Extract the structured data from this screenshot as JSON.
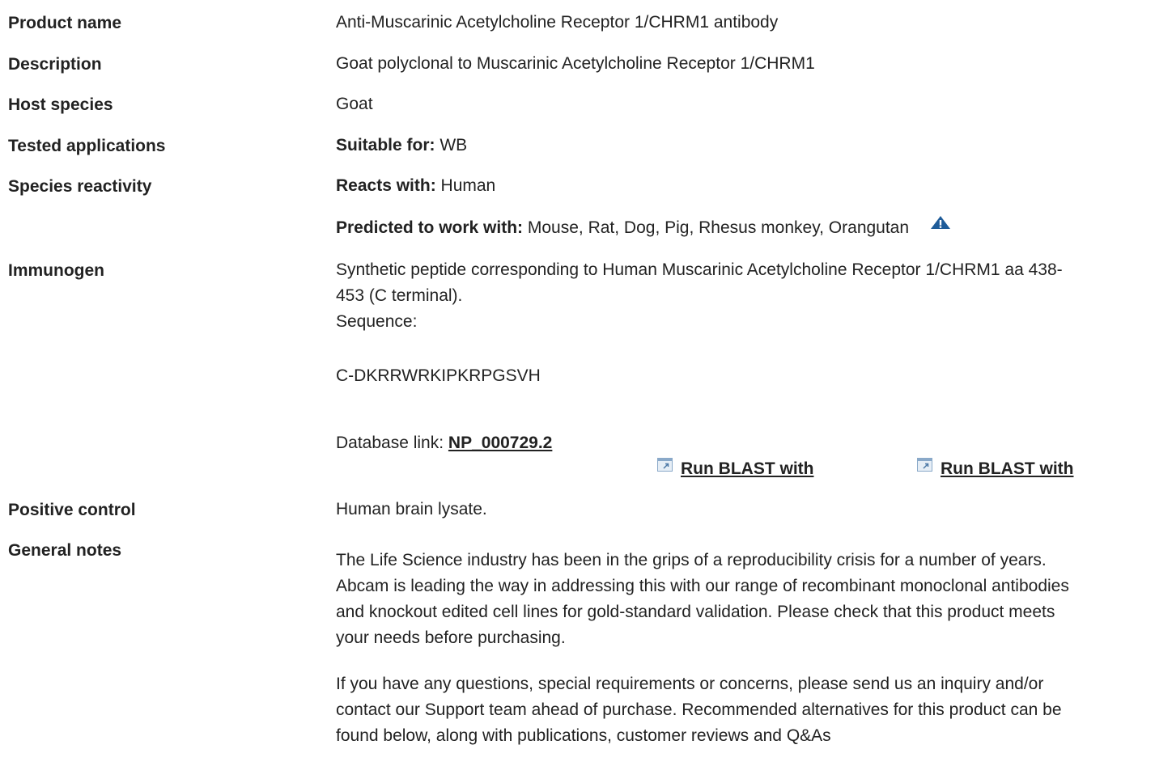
{
  "rows": {
    "product_name": {
      "label": "Product name",
      "value": "Anti-Muscarinic Acetylcholine Receptor 1/CHRM1 antibody"
    },
    "description": {
      "label": "Description",
      "value": "Goat polyclonal to Muscarinic Acetylcholine Receptor 1/CHRM1"
    },
    "host_species": {
      "label": "Host species",
      "value": "Goat"
    },
    "tested_applications": {
      "label": "Tested applications",
      "key": "Suitable for:",
      "value": " WB"
    },
    "species_reactivity": {
      "label": "Species reactivity",
      "reacts_key": "Reacts with:",
      "reacts_value": " Human",
      "predicted_key": "Predicted to work with:",
      "predicted_value": " Mouse, Rat, Dog, Pig, Rhesus monkey, Orangutan",
      "warning_icon": "warning-triangle-icon"
    },
    "immunogen": {
      "label": "Immunogen",
      "line1": "Synthetic peptide corresponding to Human Muscarinic Acetylcholine Receptor 1/CHRM1 aa 438-",
      "line2": "453 (C terminal).",
      "sequence_label": "Sequence:",
      "sequence": "C-DKRRWRKIPKRPGSVH",
      "database_label": "Database link: ",
      "database_link": "NP_000729.2",
      "blast_1": "Run BLAST with",
      "blast_2": "Run BLAST with",
      "blast_icon": "external-link-icon"
    },
    "positive_control": {
      "label": "Positive control",
      "value": "Human brain lysate."
    },
    "general_notes": {
      "label": "General notes",
      "p1_l1": "The Life Science industry has been in the grips of a reproducibility crisis for a number of years.",
      "p1_l2": "Abcam is leading the way in addressing this with our range of recombinant monoclonal antibodies",
      "p1_l3": "and knockout edited cell lines for gold-standard validation. Please check that this product meets",
      "p1_l4": "your needs before purchasing.",
      "p2_l1": "If you have any questions, special requirements or concerns, please send us an inquiry and/or",
      "p2_l2": "contact our Support team ahead of purchase. Recommended alternatives for this product can be",
      "p2_l3": "found below, along with publications, customer reviews and Q&As"
    }
  },
  "colors": {
    "text": "#222222",
    "warning_icon": "#1f5c99",
    "external_icon": "#8aa9c9"
  }
}
